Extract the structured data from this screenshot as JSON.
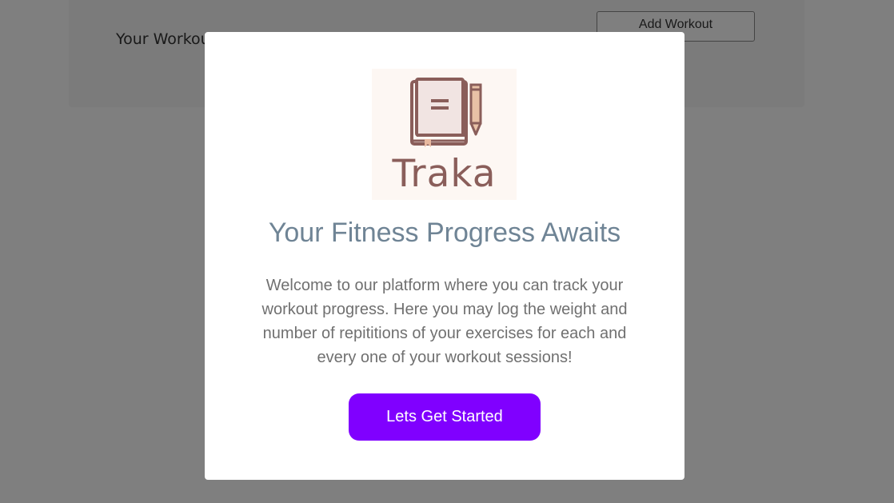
{
  "background": {
    "workouts_title": "Your Workouts",
    "add_workout_label": "Add Workout"
  },
  "modal": {
    "logo": {
      "text": "Traka",
      "icon": "book-pencil-icon"
    },
    "heading": "Your Fitness Progress Awaits",
    "body": "Welcome to our platform where you can track your workout progress. Here you may log the weight and number of repititions of your exercises for each and every one of your workout sessions!",
    "cta_label": "Lets Get Started"
  },
  "colors": {
    "accent": "#8000ff",
    "heading": "#6f8495",
    "body_text": "#707070",
    "logo_brown": "#8a5e5a",
    "logo_bg": "#fdf7f3",
    "overlay": "rgba(0,0,0,0.5)"
  }
}
